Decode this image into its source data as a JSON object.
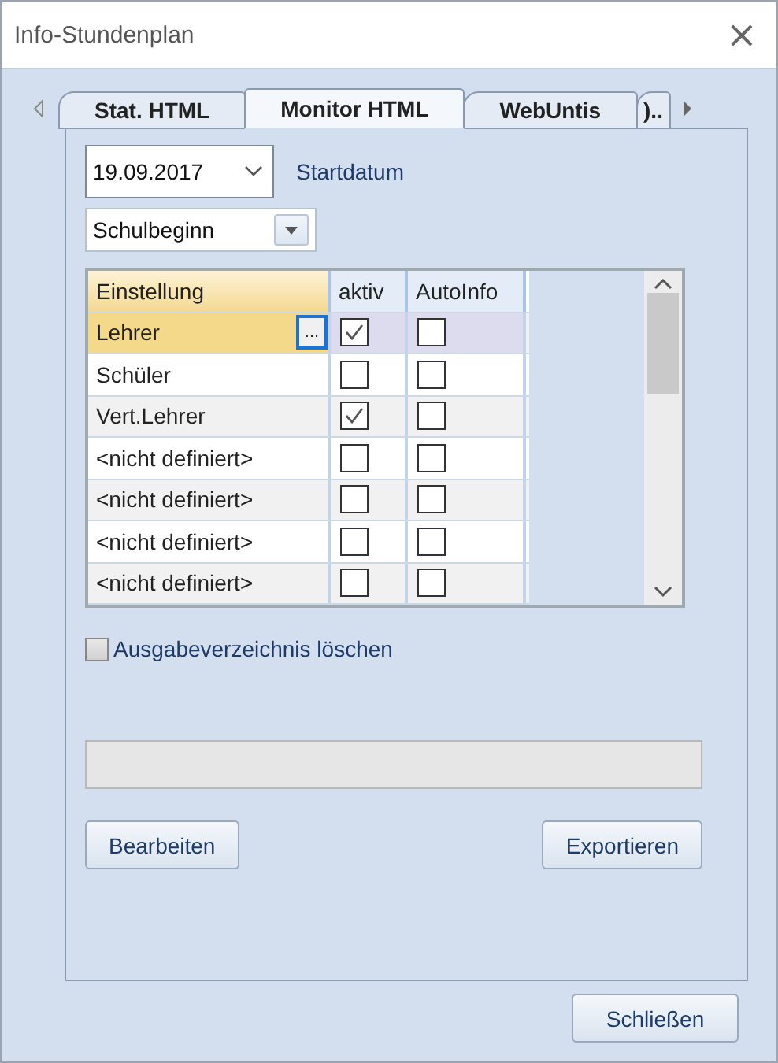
{
  "window": {
    "title": "Info-Stundenplan",
    "close": "×"
  },
  "tabs": [
    {
      "label": "Stat. HTML",
      "selected": false
    },
    {
      "label": "Monitor HTML",
      "selected": true
    },
    {
      "label": "WebUntis",
      "selected": false
    },
    {
      "label": ")..",
      "selected": false
    }
  ],
  "start_date": {
    "value": "19.09.2017",
    "label": "Startdatum"
  },
  "start_mode": {
    "value": "Schulbeginn"
  },
  "table": {
    "columns": [
      "Einstellung",
      "aktiv",
      "AutoInfo"
    ],
    "rows": [
      {
        "name": "Lehrer",
        "aktiv": true,
        "autoinfo": false,
        "selected": true,
        "edit": "..."
      },
      {
        "name": "Schüler",
        "aktiv": false,
        "autoinfo": false,
        "selected": false
      },
      {
        "name": "Vert.Lehrer",
        "aktiv": true,
        "autoinfo": false,
        "selected": false
      },
      {
        "name": "<nicht definiert>",
        "aktiv": false,
        "autoinfo": false,
        "selected": false
      },
      {
        "name": "<nicht definiert>",
        "aktiv": false,
        "autoinfo": false,
        "selected": false
      },
      {
        "name": "<nicht definiert>",
        "aktiv": false,
        "autoinfo": false,
        "selected": false
      },
      {
        "name": "<nicht definiert>",
        "aktiv": false,
        "autoinfo": false,
        "selected": false
      }
    ]
  },
  "clear_output": {
    "label": "Ausgabeverzeichnis löschen",
    "checked": false
  },
  "progress": {
    "level": 0
  },
  "buttons": {
    "edit": "Bearbeiten",
    "export": "Exportieren",
    "close": "Schließen"
  }
}
